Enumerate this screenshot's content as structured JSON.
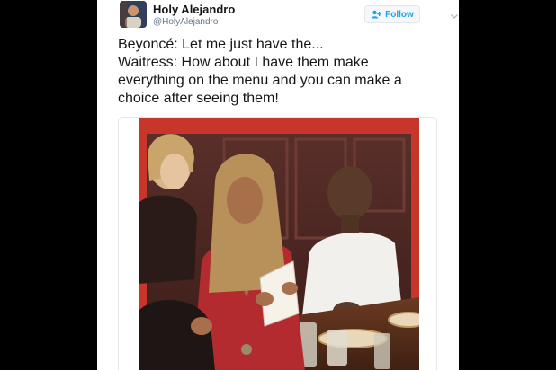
{
  "tweet": {
    "author": {
      "display_name": "Holy Alejandro",
      "handle": "@HolyAlejandro",
      "avatar_icon": "user-avatar"
    },
    "follow_button": {
      "label": "Follow",
      "icon": "follow-person-plus-icon"
    },
    "menu_icon": "chevron-down-icon",
    "text_lines": [
      "Beyoncé: Let me just have the...",
      "Waitress: How about I have them make",
      "everything on the menu and you can make a",
      "choice after seeing them!"
    ],
    "media": {
      "kind": "photo",
      "frame_color": "#c8352a"
    }
  },
  "colors": {
    "background": "#000000",
    "card": "#ffffff",
    "accent": "#1da1f2",
    "text": "#14171a",
    "muted": "#657786"
  }
}
